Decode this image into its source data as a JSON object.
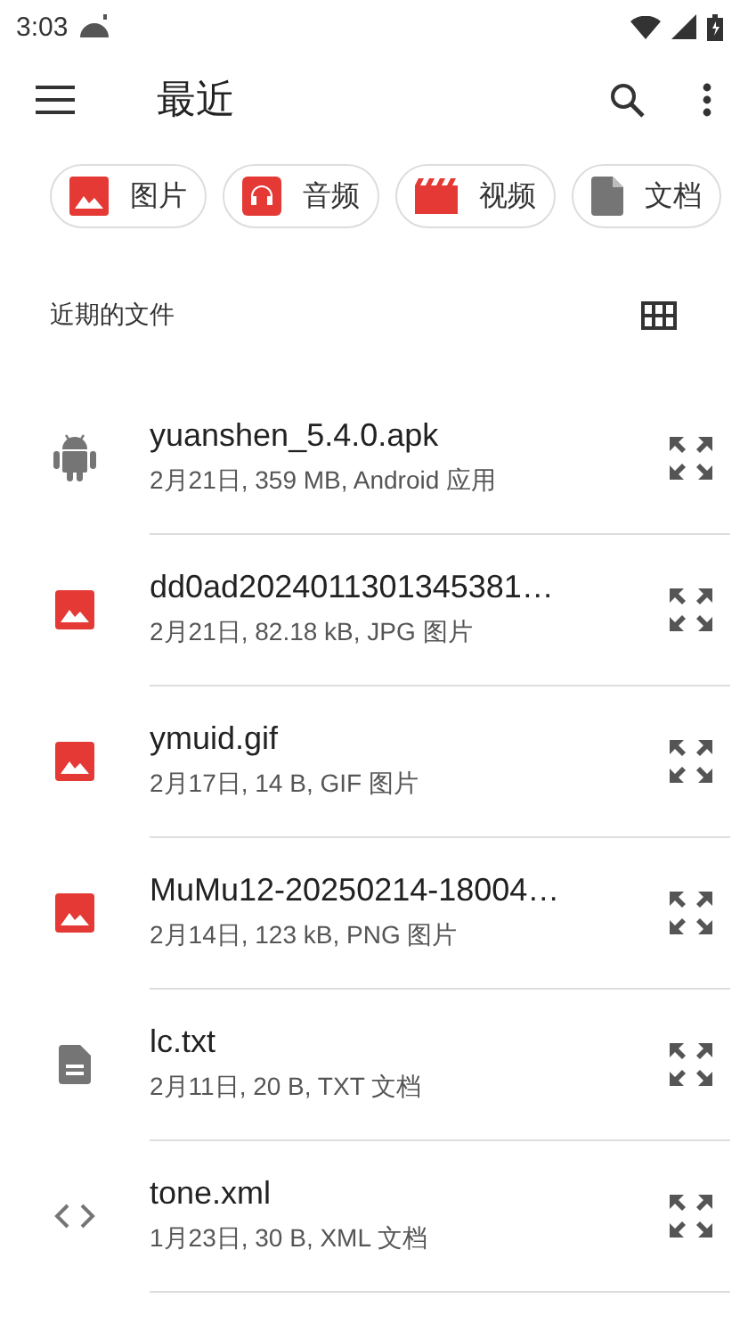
{
  "status_bar": {
    "time": "3:03"
  },
  "app_bar": {
    "title": "最近"
  },
  "chips": [
    {
      "kind": "image",
      "label": "图片"
    },
    {
      "kind": "audio",
      "label": "音频"
    },
    {
      "kind": "video",
      "label": "视频"
    },
    {
      "kind": "document",
      "label": "文档"
    }
  ],
  "section": {
    "title": "近期的文件"
  },
  "files": [
    {
      "kind": "apk",
      "name": "yuanshen_5.4.0.apk",
      "details": "2月21日, 359 MB, Android 应用"
    },
    {
      "kind": "image",
      "name": "dd0ad2024011301345381…",
      "details": "2月21日, 82.18 kB, JPG 图片"
    },
    {
      "kind": "image",
      "name": "ymuid.gif",
      "details": "2月17日, 14 B, GIF 图片"
    },
    {
      "kind": "image",
      "name": "MuMu12-20250214-18004…",
      "details": "2月14日, 123 kB, PNG 图片"
    },
    {
      "kind": "text",
      "name": "lc.txt",
      "details": "2月11日, 20 B, TXT 文档"
    },
    {
      "kind": "code",
      "name": "tone.xml",
      "details": "1月23日, 30 B, XML 文档"
    }
  ]
}
